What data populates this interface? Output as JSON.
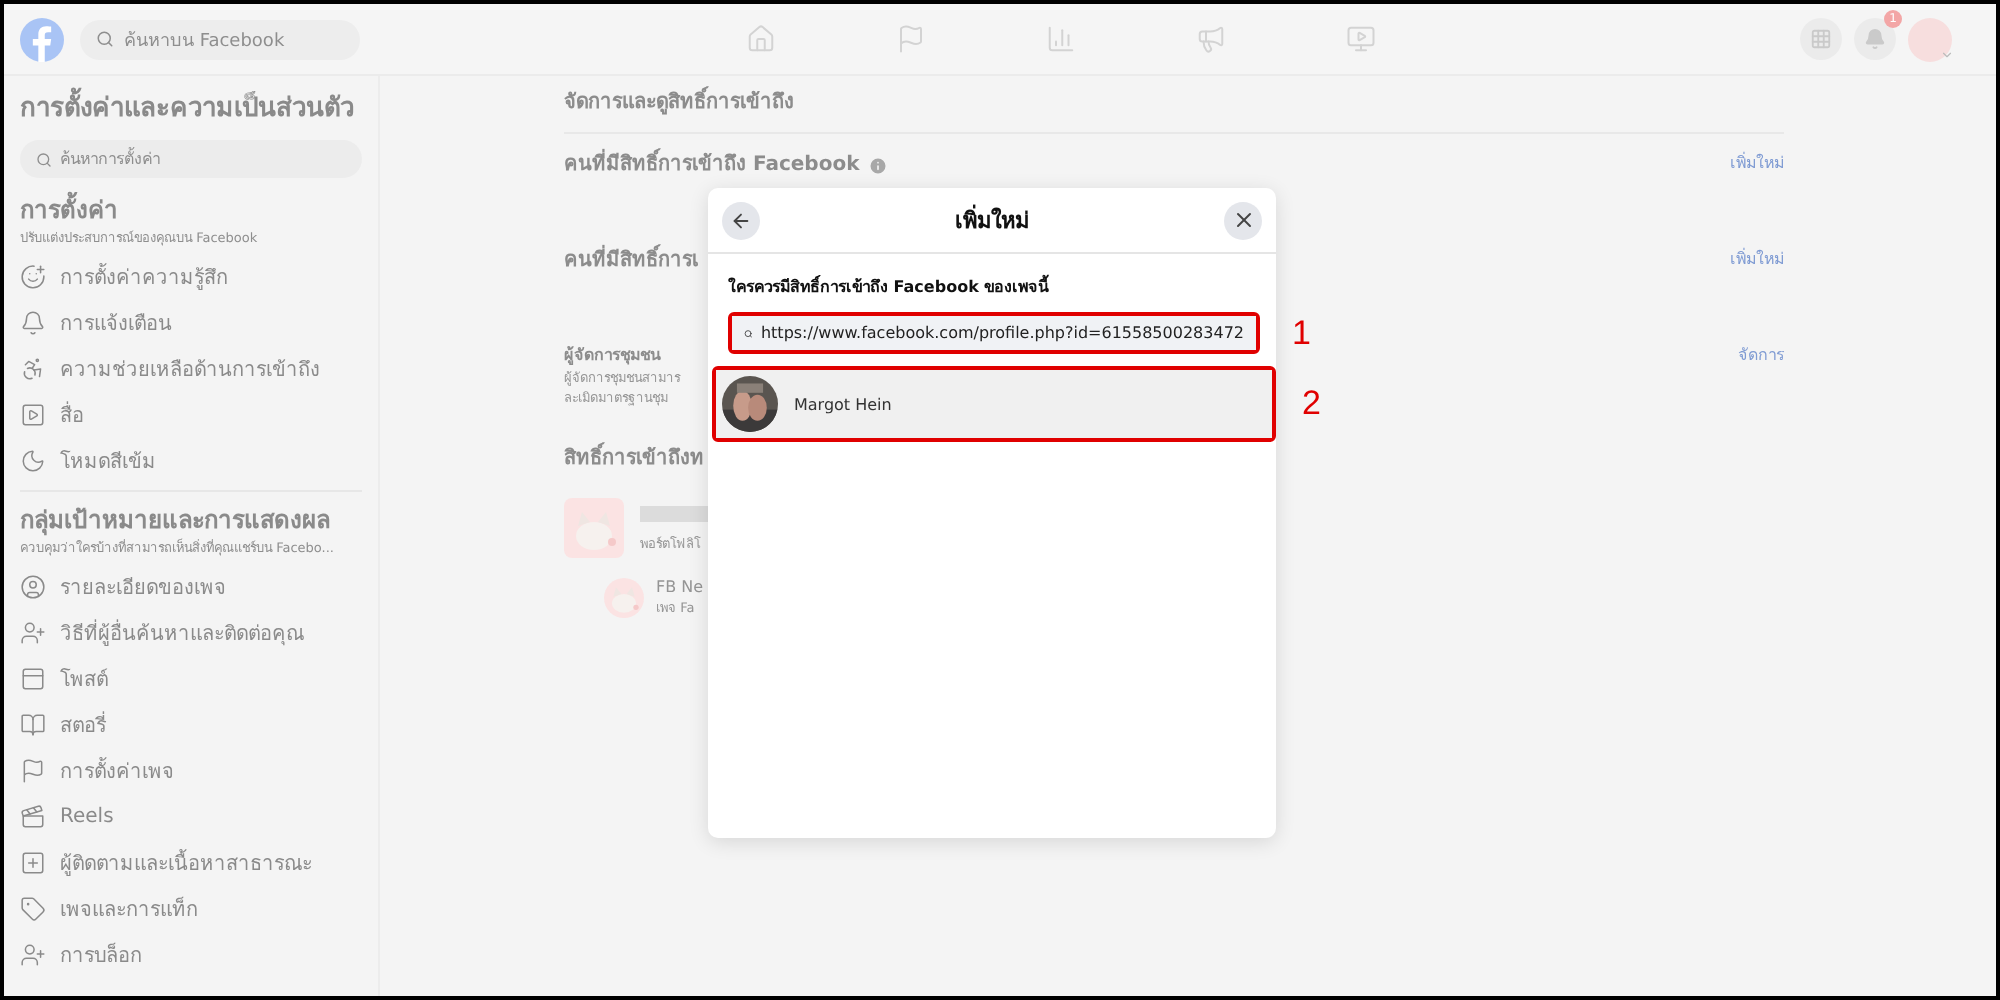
{
  "topbar": {
    "search_placeholder": "ค้นหาบน Facebook",
    "nav": [
      {
        "kind": "home"
      },
      {
        "kind": "flag"
      },
      {
        "kind": "chart"
      },
      {
        "kind": "megaphone"
      },
      {
        "kind": "video"
      }
    ],
    "notification_badge": "1"
  },
  "sidebar": {
    "title": "การตั้งค่าและความเป็นส่วนตัว",
    "search_placeholder": "ค้นหาการตั้งค่า",
    "sections": [
      {
        "title": "การตั้งค่า",
        "subtitle": "ปรับแต่งประสบการณ์ของคุณบน Facebook",
        "items": [
          {
            "label": "การตั้งค่าความรู้สึก",
            "kind": "reaction"
          },
          {
            "label": "การแจ้งเตือน",
            "kind": "bell"
          },
          {
            "label": "ความช่วยเหลือด้านการเข้าถึง",
            "kind": "accessibility"
          },
          {
            "label": "สื่อ",
            "kind": "media"
          },
          {
            "label": "โหมดสีเข้ม",
            "kind": "moon"
          }
        ]
      },
      {
        "title": "กลุ่มเป้าหมายและการแสดงผล",
        "subtitle": "ควบคุมว่าใครบ้างที่สามารถเห็นสิ่งที่คุณแชร์บน Facebo...",
        "items": [
          {
            "label": "รายละเอียดของเพจ",
            "kind": "profile"
          },
          {
            "label": "วิธีที่ผู้อื่นค้นหาและติดต่อคุณ",
            "kind": "contact"
          },
          {
            "label": "โพสต์",
            "kind": "post"
          },
          {
            "label": "สตอรี่",
            "kind": "story"
          },
          {
            "label": "การตั้งค่าเพจ",
            "kind": "flag"
          },
          {
            "label": "Reels",
            "kind": "reels"
          },
          {
            "label": "ผู้ติดตามและเนื้อหาสาธารณะ",
            "kind": "followers"
          },
          {
            "label": "เพจและการแท็ก",
            "kind": "tag"
          },
          {
            "label": "การบล็อก",
            "kind": "contact"
          }
        ]
      }
    ]
  },
  "main": {
    "heading": "จัดการและดูสิทธิ์การเข้าถึง",
    "rows": [
      {
        "kind": "heading_info",
        "title": "คนที่มีสิทธิ์การเข้าถึง Facebook",
        "action": "เพิ่มใหม่"
      },
      {
        "kind": "heading",
        "title": "คนที่มีสิทธิ์การเ",
        "action": "เพิ่มใหม่"
      },
      {
        "kind": "detail",
        "title": "ผู้จัดการชุมชน",
        "lines": [
          "ผู้จัดการชุมชนสามาร",
          "ละเมิดมาตรฐานชุม"
        ],
        "action": "จัดการ"
      }
    ],
    "access_heading": "สิทธิ์การเข้าถึงท",
    "portfolio": {
      "caption": "พอร์ตโฟลิโ",
      "child_name": "FB Ne",
      "child_caption": "เพจ Fa"
    }
  },
  "dialog": {
    "title": "เพิ่มใหม่",
    "prompt": "ใครควรมีสิทธิ์การเข้าถึง Facebook ของเพจนี้",
    "search_value": "https://www.facebook.com/profile.php?id=61558500283472",
    "search_annotation": "1",
    "results": [
      {
        "name": "Margot Hein",
        "highlighted": true,
        "annotation": "2"
      }
    ]
  }
}
